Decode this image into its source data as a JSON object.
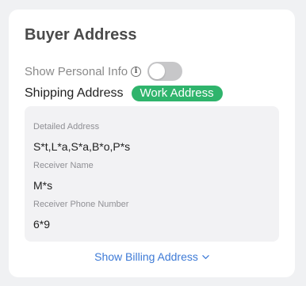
{
  "card": {
    "title": "Buyer Address",
    "show_personal_info_label": "Show Personal Info",
    "toggle_on": false,
    "shipping_label": "Shipping Address",
    "shipping_badge": "Work Address",
    "fields": [
      {
        "label": "Detailed Address",
        "value": "S*t,L*a,S*a,B*o,P*s"
      },
      {
        "label": "Receiver Name",
        "value": "M*s"
      },
      {
        "label": "Receiver Phone Number",
        "value": "6*9"
      }
    ],
    "footer_link": "Show Billing Address"
  },
  "colors": {
    "badge": "#2fb46c",
    "link": "#3d7ad6",
    "toggle_off": "#c7c7c9"
  },
  "icons": [
    "info-icon",
    "chevron-down-icon"
  ]
}
